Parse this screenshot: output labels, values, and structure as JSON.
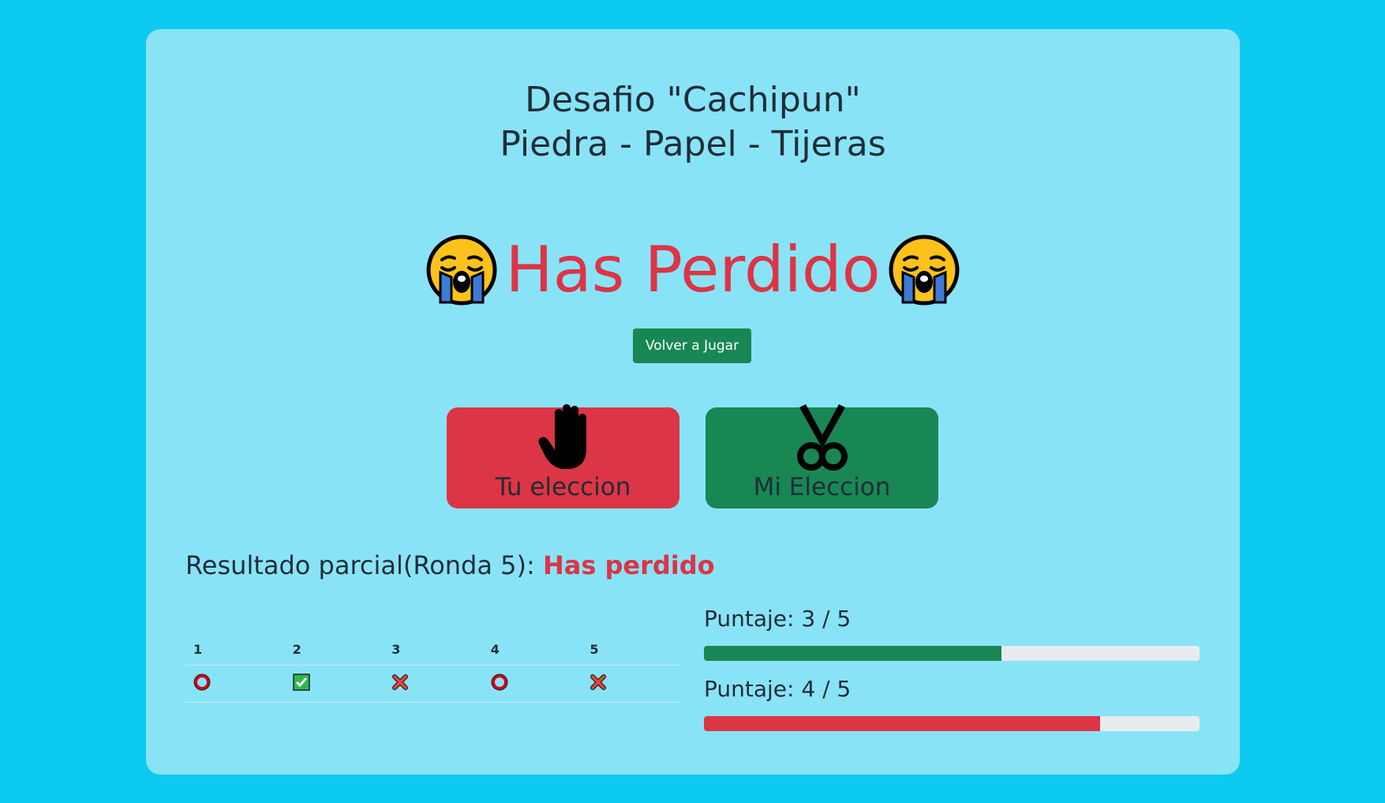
{
  "title": {
    "line1": "Desafio \"Cachipun\"",
    "line2": "Piedra - Papel - Tijeras"
  },
  "result": {
    "text": "Has Perdido",
    "emoji": "loudly-crying-face-icon",
    "color": "#dc3545"
  },
  "replay_button": {
    "label": "Volver a Jugar",
    "color": "#198754"
  },
  "choices": {
    "yours": {
      "label": "Tu eleccion",
      "icon": "hand-paper-icon",
      "color": "#dc3545"
    },
    "mine": {
      "label": "Mi Eleccion",
      "icon": "scissors-icon",
      "color": "#198754"
    }
  },
  "partial": {
    "prefix": "Resultado parcial(Ronda 5): ",
    "status": "Has perdido"
  },
  "rounds": {
    "headers": [
      "1",
      "2",
      "3",
      "4",
      "5"
    ],
    "results": [
      {
        "round": "1",
        "icon": "circle-icon",
        "meaning": "empate"
      },
      {
        "round": "2",
        "icon": "check-icon",
        "meaning": "ganado"
      },
      {
        "round": "3",
        "icon": "cross-icon",
        "meaning": "perdido"
      },
      {
        "round": "4",
        "icon": "circle-icon",
        "meaning": "empate"
      },
      {
        "round": "5",
        "icon": "cross-icon",
        "meaning": "perdido"
      }
    ]
  },
  "scores": [
    {
      "label": "Puntaje: 3 / 5",
      "value": 3,
      "max": 5,
      "color": "#198754"
    },
    {
      "label": "Puntaje: 4 / 5",
      "value": 4,
      "max": 5,
      "color": "#dc3545"
    }
  ],
  "colors": {
    "page_background": "#0dcaf0",
    "card_background": "#89e3f7",
    "track": "#e9ecef"
  }
}
